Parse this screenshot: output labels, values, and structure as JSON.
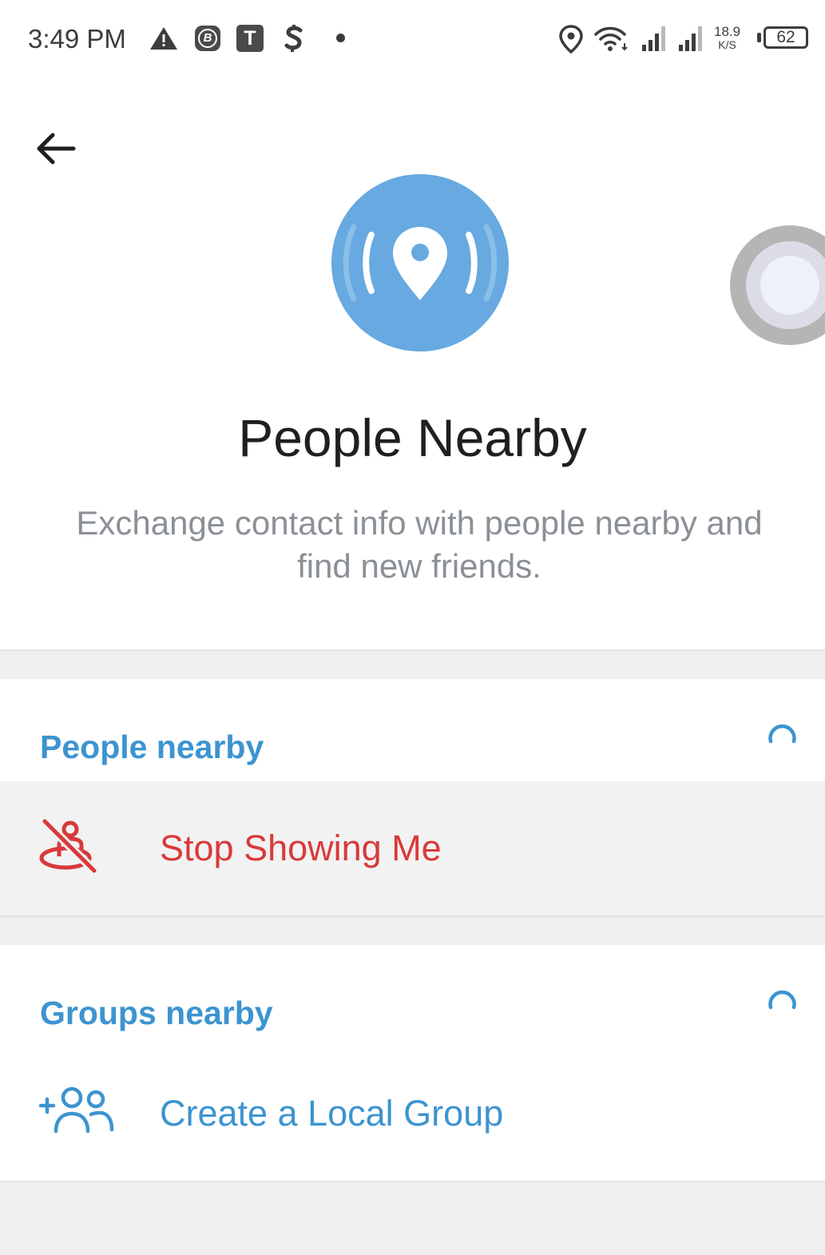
{
  "status_bar": {
    "time": "3:49 PM",
    "notification_icons": [
      "warning-icon",
      "b-app-icon",
      "t-app-icon",
      "s-app-icon",
      "dot-icon"
    ],
    "t_app_letter": "T",
    "b_app_letter": "B",
    "network_speed_value": "18.9",
    "network_speed_unit": "K/S",
    "battery_level": "62"
  },
  "header": {
    "back_icon": "arrow-left-icon",
    "hero_icon": "location-broadcast-icon",
    "title": "People Nearby",
    "subtitle": "Exchange contact info with people nearby and find new friends."
  },
  "people_section": {
    "header": "People nearby",
    "loading_icon": "spinner-icon",
    "action": {
      "label": "Stop Showing Me",
      "icon": "hide-location-icon",
      "color": "#d9393a"
    }
  },
  "groups_section": {
    "header": "Groups nearby",
    "loading_icon": "spinner-icon",
    "action": {
      "label": "Create a Local Group",
      "icon": "add-group-icon",
      "color": "#3c94d0"
    }
  },
  "colors": {
    "accent": "#3c94d0",
    "hero_circle": "#67a9e0",
    "danger": "#d9393a",
    "subtitle_gray": "#8b9097",
    "background_gray": "#efeff0"
  }
}
